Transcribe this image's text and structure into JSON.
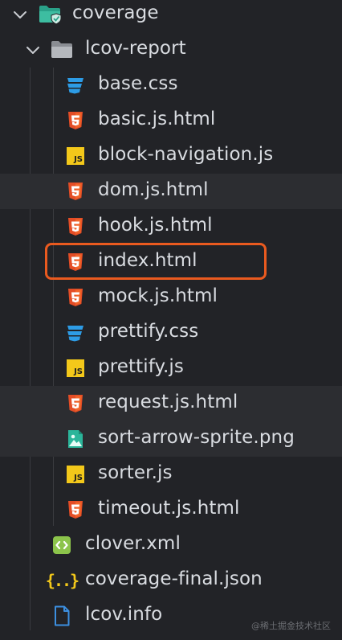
{
  "tree": {
    "root": {
      "label": "coverage",
      "icon": "folder-coverage-icon",
      "expanded": true
    },
    "sub": {
      "label": "lcov-report",
      "icon": "folder-icon",
      "expanded": true
    },
    "report_files": [
      {
        "label": "base.css",
        "icon": "css-icon"
      },
      {
        "label": "basic.js.html",
        "icon": "html-icon"
      },
      {
        "label": "block-navigation.js",
        "icon": "js-icon"
      },
      {
        "label": "dom.js.html",
        "icon": "html-icon"
      },
      {
        "label": "hook.js.html",
        "icon": "html-icon"
      },
      {
        "label": "index.html",
        "icon": "html-icon"
      },
      {
        "label": "mock.js.html",
        "icon": "html-icon"
      },
      {
        "label": "prettify.css",
        "icon": "css-icon"
      },
      {
        "label": "prettify.js",
        "icon": "js-icon"
      },
      {
        "label": "request.js.html",
        "icon": "html-icon"
      },
      {
        "label": "sort-arrow-sprite.png",
        "icon": "image-icon"
      },
      {
        "label": "sorter.js",
        "icon": "js-icon"
      },
      {
        "label": "timeout.js.html",
        "icon": "html-icon"
      }
    ],
    "coverage_files": [
      {
        "label": "clover.xml",
        "icon": "xml-icon"
      },
      {
        "label": "coverage-final.json",
        "icon": "json-icon"
      },
      {
        "label": "lcov.info",
        "icon": "file-icon"
      }
    ]
  },
  "icon_text": {
    "js": "JS",
    "json": "{..}"
  },
  "watermark": "@稀土掘金技术社区",
  "colors": {
    "background": "#222327",
    "highlight_row": "#2c2d31",
    "annotation": "#ea5a1f",
    "html": "#e44d26",
    "css": "#2d9ce6",
    "js": "#f3c81a",
    "folder": "#3dbda1"
  }
}
